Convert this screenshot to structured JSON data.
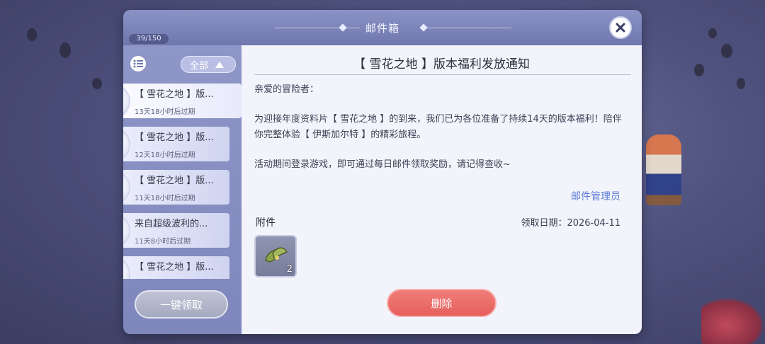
{
  "window": {
    "title": "邮件箱",
    "counter": "39/150",
    "close_icon": "close-icon"
  },
  "sidebar": {
    "filter_label": "全部",
    "claim_all_label": "一键领取",
    "mails": [
      {
        "title": "【 雪花之地 】版...",
        "expiry": "13天18小时后过期",
        "status": "已领取",
        "selected": true
      },
      {
        "title": "【 雪花之地 】版...",
        "expiry": "12天18小时后过期",
        "status": "已领取"
      },
      {
        "title": "【 雪花之地 】版...",
        "expiry": "11天18小时后过期",
        "status": "已领取"
      },
      {
        "title": "来自超级波利的...",
        "expiry": "11天8小时后过期",
        "status": "已领取"
      },
      {
        "title": "【 雪花之地 】版...",
        "expiry": "",
        "status": "已领取"
      }
    ]
  },
  "mail": {
    "subject": "【 雪花之地 】版本福利发放通知",
    "greeting": "亲爱的冒险者：",
    "para1": "为迎接年度资料片【 雪花之地 】的到来，我们已为各位准备了持续14天的版本福利！陪伴你完整体验【 伊斯加尔特 】的精彩旅程。",
    "para2": "活动期间登录游戏，即可通过每日邮件领取奖励，请记得查收~",
    "sender": "邮件管理员",
    "attachment_label": "附件",
    "claim_date": "领取日期：2026-04-11",
    "attachment": {
      "icon": "leaf-item-icon",
      "count": "2"
    },
    "delete_label": "删除"
  },
  "colors": {
    "title_bar": "#7b83ba",
    "delete": "#e9696a",
    "sender_link": "#5c7cd8"
  }
}
